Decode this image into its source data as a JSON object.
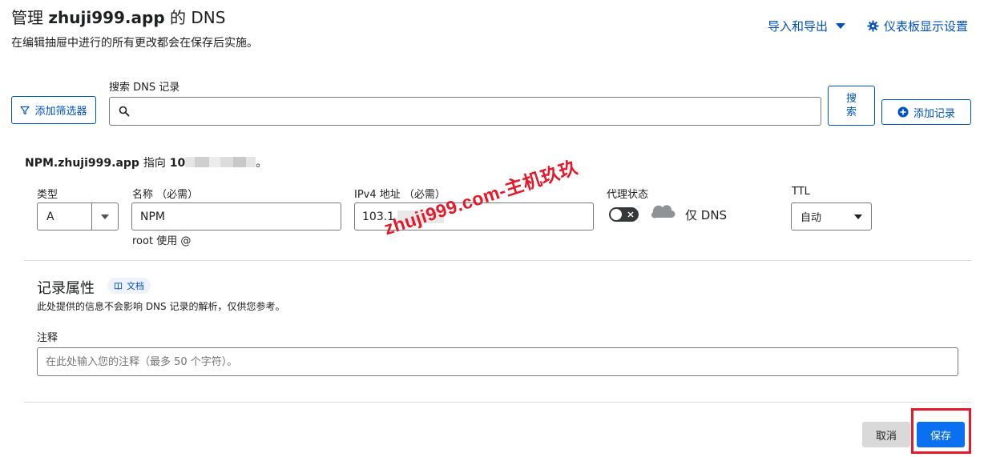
{
  "header": {
    "title_prefix": "管理",
    "title_domain": "zhuji999.app",
    "title_suffix": "的 DNS",
    "subtitle": "在编辑抽屉中进行的所有更改都会在保存后实施。",
    "import_export_label": "导入和导出",
    "dashboard_settings_label": "仪表板显示设置"
  },
  "toolbar": {
    "filter_button": "添加筛选器",
    "search_label": "搜索 DNS 记录",
    "search_value": "",
    "search_button": "搜索",
    "add_record_button": "添加记录"
  },
  "record": {
    "heading_name": "NPM.zhuji999.app",
    "heading_points_to": "指向",
    "heading_ip_visible": "10",
    "heading_end": "。",
    "type_label": "类型",
    "type_value": "A",
    "name_label": "名称 （必需）",
    "name_value": "NPM",
    "name_hint": "root 使用 @",
    "ipv4_label": "IPv4 地址 （必需）",
    "ipv4_value": "103.1",
    "proxy_label": "代理状态",
    "proxy_status_text": "仅 DNS",
    "proxy_enabled": false,
    "ttl_label": "TTL",
    "ttl_value": "自动"
  },
  "attributes": {
    "heading": "记录属性",
    "docs_badge": "文档",
    "description": "此处提供的信息不会影响 DNS 记录的解析，仅供您参考。",
    "comment_label": "注释",
    "comment_placeholder": "在此处输入您的注释（最多 50 个字符）。"
  },
  "footer": {
    "cancel_button": "取消",
    "save_button": "保存"
  },
  "watermark": "zhuji999.com-主机玖玖",
  "colors": {
    "link_blue": "#0051c3",
    "primary_button": "#0a6ff1",
    "highlight_red": "#e6192b"
  }
}
